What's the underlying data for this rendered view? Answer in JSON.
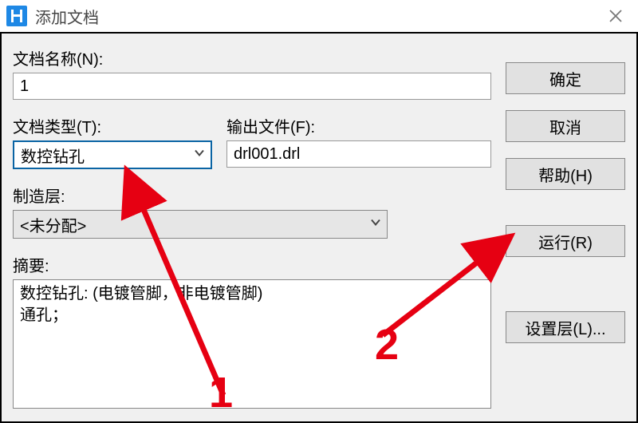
{
  "window": {
    "title": "添加文档"
  },
  "labels": {
    "name": "文档名称(N):",
    "type": "文档类型(T):",
    "output": "输出文件(F):",
    "layer": "制造层:",
    "summary": "摘要:"
  },
  "fields": {
    "name_value": "1",
    "type_value": "数控钻孔",
    "output_value": "drl001.drl",
    "layer_value": "<未分配>",
    "summary_text": "数控钻孔: (电镀管脚，非电镀管脚)\n通孔；"
  },
  "buttons": {
    "ok": "确定",
    "cancel": "取消",
    "help": "帮助(H)",
    "run": "运行(R)",
    "set_layer": "设置层(L)..."
  },
  "annotations": {
    "one": "1",
    "two": "2"
  }
}
